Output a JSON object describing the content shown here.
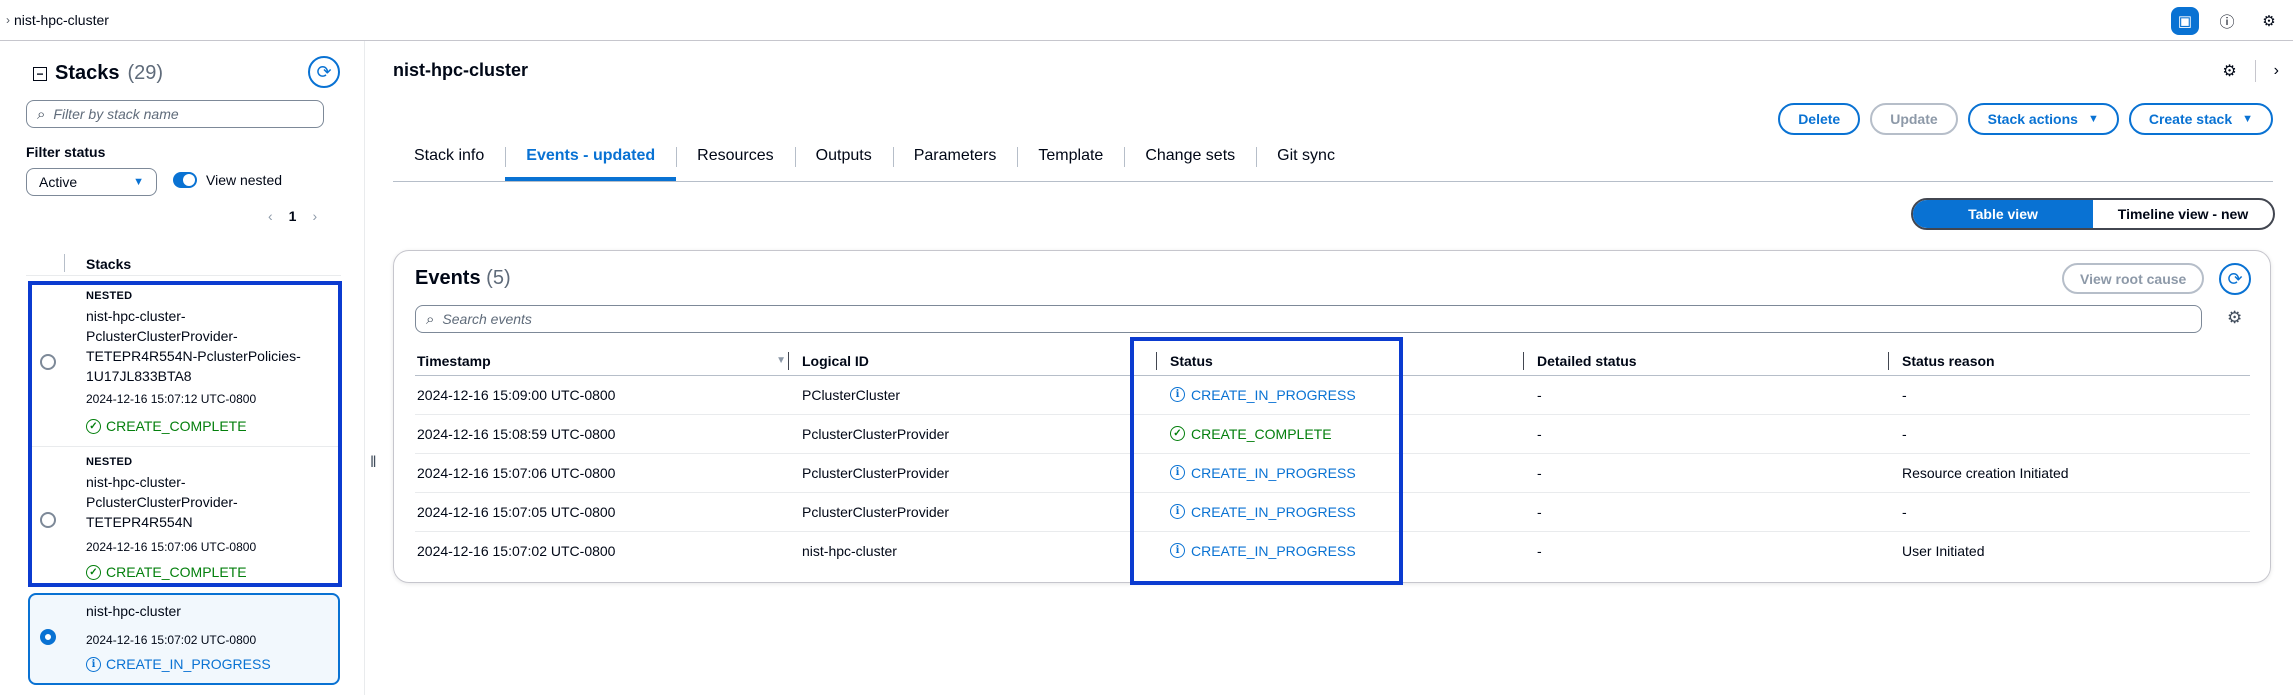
{
  "breadcrumb": "nist-hpc-cluster",
  "sidebar": {
    "title": "Stacks",
    "count": "(29)",
    "search_placeholder": "Filter by stack name",
    "filter_label": "Filter status",
    "filter_value": "Active",
    "view_nested_label": "View nested",
    "page": "1",
    "column_header": "Stacks",
    "stacks": [
      {
        "tag": "NESTED",
        "name": "nist-hpc-cluster-PclusterClusterProvider-TETEPR4R554N-PclusterPolicies-1U17JL833BTA8",
        "timestamp": "2024-12-16 15:07:12 UTC-0800",
        "status": "CREATE_COMPLETE"
      },
      {
        "tag": "NESTED",
        "name": "nist-hpc-cluster-PclusterClusterProvider-TETEPR4R554N",
        "timestamp": "2024-12-16 15:07:06 UTC-0800",
        "status": "CREATE_COMPLETE"
      },
      {
        "tag": "",
        "name": "nist-hpc-cluster",
        "timestamp": "2024-12-16 15:07:02 UTC-0800",
        "status": "CREATE_IN_PROGRESS"
      }
    ]
  },
  "main": {
    "title": "nist-hpc-cluster",
    "buttons": {
      "delete": "Delete",
      "update": "Update",
      "stack_actions": "Stack actions",
      "create_stack": "Create stack"
    },
    "tabs": [
      "Stack info",
      "Events - updated",
      "Resources",
      "Outputs",
      "Parameters",
      "Template",
      "Change sets",
      "Git sync"
    ],
    "active_tab": "Events - updated",
    "view_toggle": {
      "table": "Table view",
      "timeline": "Timeline view - new"
    },
    "events": {
      "title": "Events",
      "count": "(5)",
      "view_root_cause": "View root cause",
      "search_placeholder": "Search events",
      "columns": [
        "Timestamp",
        "Logical ID",
        "Status",
        "Detailed status",
        "Status reason"
      ],
      "rows": [
        {
          "timestamp": "2024-12-16 15:09:00 UTC-0800",
          "logical_id": "PClusterCluster",
          "status": "CREATE_IN_PROGRESS",
          "detailed": "-",
          "reason": "-"
        },
        {
          "timestamp": "2024-12-16 15:08:59 UTC-0800",
          "logical_id": "PclusterClusterProvider",
          "status": "CREATE_COMPLETE",
          "detailed": "-",
          "reason": "-"
        },
        {
          "timestamp": "2024-12-16 15:07:06 UTC-0800",
          "logical_id": "PclusterClusterProvider",
          "status": "CREATE_IN_PROGRESS",
          "detailed": "-",
          "reason": "Resource creation Initiated"
        },
        {
          "timestamp": "2024-12-16 15:07:05 UTC-0800",
          "logical_id": "PclusterClusterProvider",
          "status": "CREATE_IN_PROGRESS",
          "detailed": "-",
          "reason": "-"
        },
        {
          "timestamp": "2024-12-16 15:07:02 UTC-0800",
          "logical_id": "nist-hpc-cluster",
          "status": "CREATE_IN_PROGRESS",
          "detailed": "-",
          "reason": "User Initiated"
        }
      ]
    }
  },
  "colors": {
    "accent": "#0972d3",
    "success": "#037f0c",
    "highlight": "#0b3bd0"
  }
}
